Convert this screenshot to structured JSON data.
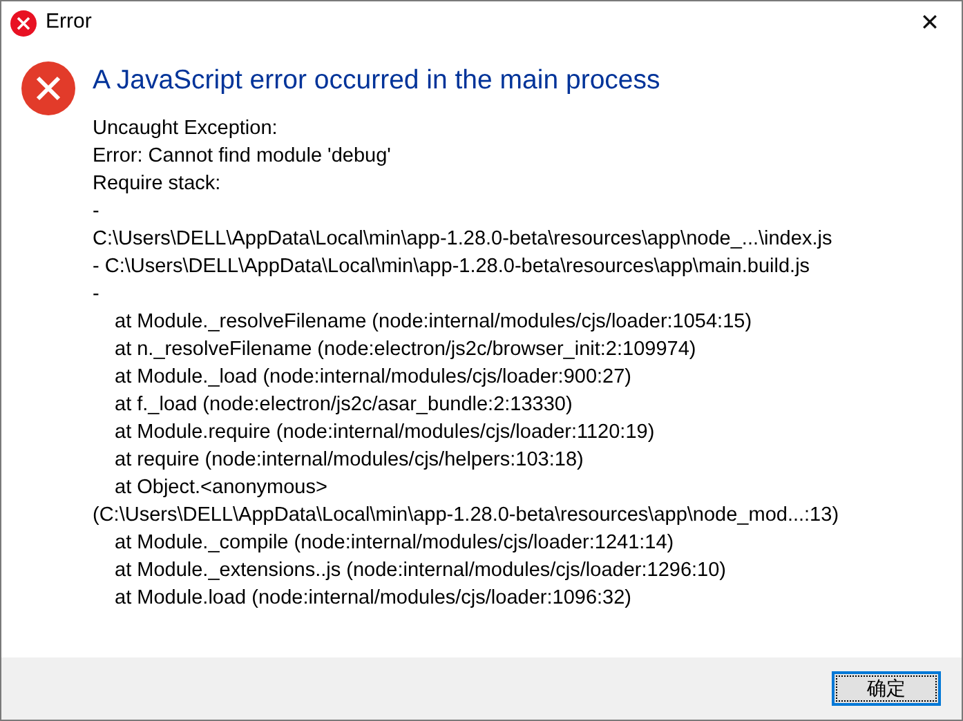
{
  "window": {
    "title": "Error",
    "close_glyph": "✕"
  },
  "heading": "A JavaScript error occurred in the main process",
  "message_lines": [
    {
      "kind": "plain",
      "text": "Uncaught Exception:"
    },
    {
      "kind": "plain",
      "text": "Error: Cannot find module 'debug'"
    },
    {
      "kind": "plain",
      "text": "Require stack:"
    },
    {
      "kind": "plain",
      "text": "-"
    },
    {
      "kind": "plain",
      "text": "C:\\Users\\DELL\\AppData\\Local\\min\\app-1.28.0-beta\\resources\\app\\node_...\\index.js"
    },
    {
      "kind": "plain",
      "text": "- C:\\Users\\DELL\\AppData\\Local\\min\\app-1.28.0-beta\\resources\\app\\main.build.js"
    },
    {
      "kind": "plain",
      "text": "-"
    },
    {
      "kind": "frame",
      "text": "at Module._resolveFilename (node:internal/modules/cjs/loader:1054:15)"
    },
    {
      "kind": "frame",
      "text": "at n._resolveFilename (node:electron/js2c/browser_init:2:109974)"
    },
    {
      "kind": "frame",
      "text": "at Module._load (node:internal/modules/cjs/loader:900:27)"
    },
    {
      "kind": "frame",
      "text": "at f._load (node:electron/js2c/asar_bundle:2:13330)"
    },
    {
      "kind": "frame",
      "text": "at Module.require (node:internal/modules/cjs/loader:1120:19)"
    },
    {
      "kind": "frame",
      "text": "at require (node:internal/modules/cjs/helpers:103:18)"
    },
    {
      "kind": "frame",
      "text": "at Object.<anonymous>"
    },
    {
      "kind": "plain",
      "text": "(C:\\Users\\DELL\\AppData\\Local\\min\\app-1.28.0-beta\\resources\\app\\node_mod...:13)"
    },
    {
      "kind": "frame",
      "text": "at Module._compile (node:internal/modules/cjs/loader:1241:14)"
    },
    {
      "kind": "frame",
      "text": "at Module._extensions..js (node:internal/modules/cjs/loader:1296:10)"
    },
    {
      "kind": "frame",
      "text": "at Module.load (node:internal/modules/cjs/loader:1096:32)"
    }
  ],
  "buttons": [
    {
      "label": "确定",
      "selected": true
    }
  ]
}
